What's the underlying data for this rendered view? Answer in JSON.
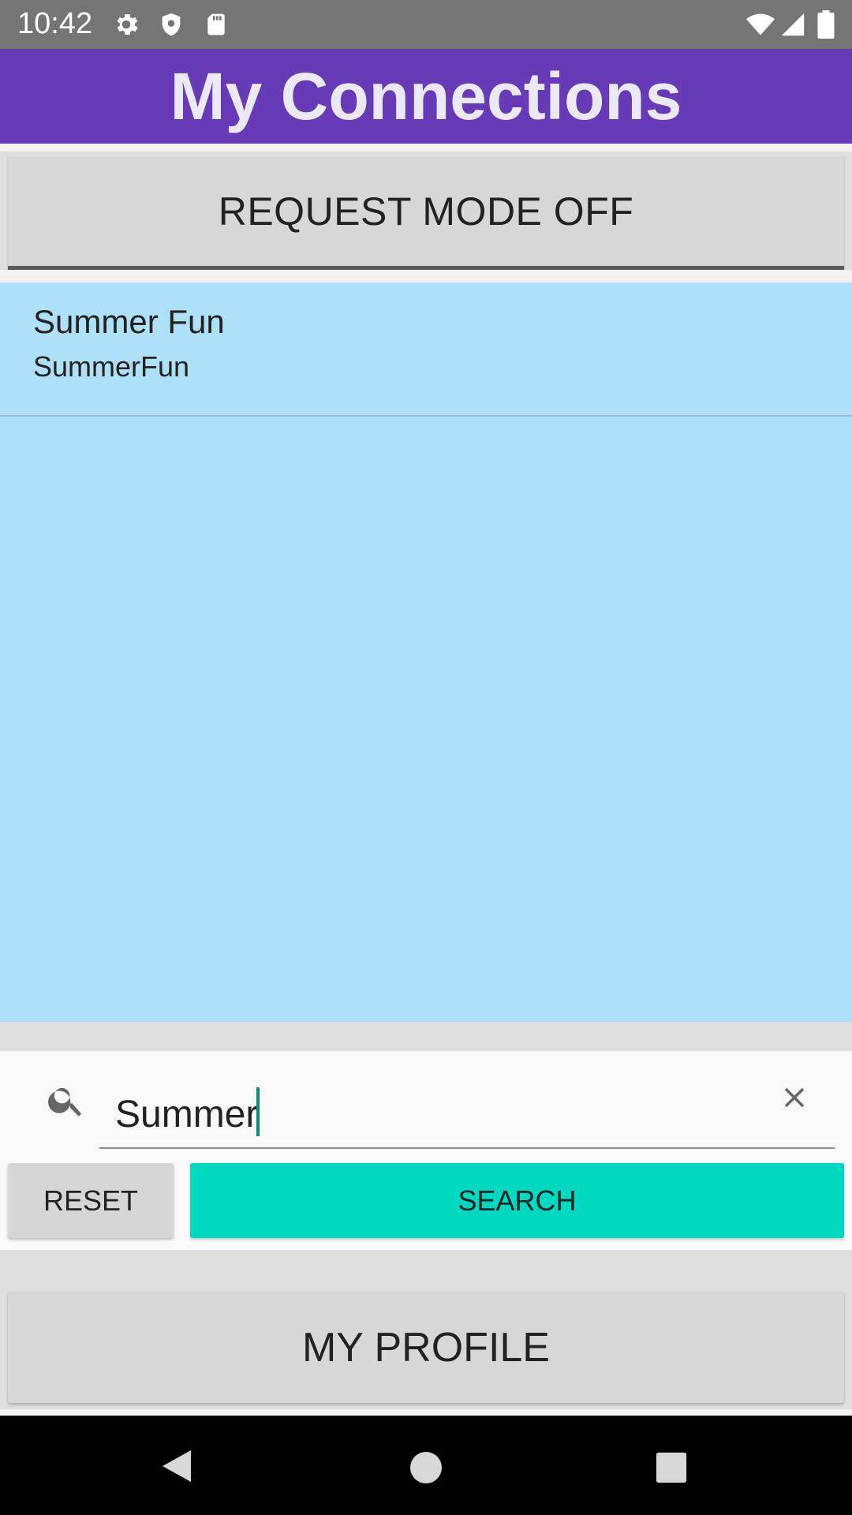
{
  "status_bar": {
    "time": "10:42",
    "left_icons": [
      "gear-icon",
      "shield-icon",
      "sd-card-icon"
    ],
    "right_icons": [
      "wifi-icon",
      "signal-icon",
      "battery-icon"
    ]
  },
  "app_bar": {
    "title": "My Connections",
    "color": "#673ab7"
  },
  "request_mode_button": {
    "label": "REQUEST MODE OFF"
  },
  "connections": [
    {
      "name": "Summer Fun",
      "handle": "SummerFun"
    }
  ],
  "search": {
    "value": "Summer",
    "icon": "search-icon",
    "clear_icon": "close-icon"
  },
  "buttons": {
    "reset": "RESET",
    "search": "SEARCH",
    "my_profile": "MY PROFILE"
  },
  "colors": {
    "list_background": "#aee0f7",
    "search_button": "#00d9c2"
  },
  "nav_bar": {
    "icons": [
      "back-icon",
      "home-icon",
      "recents-icon"
    ]
  }
}
